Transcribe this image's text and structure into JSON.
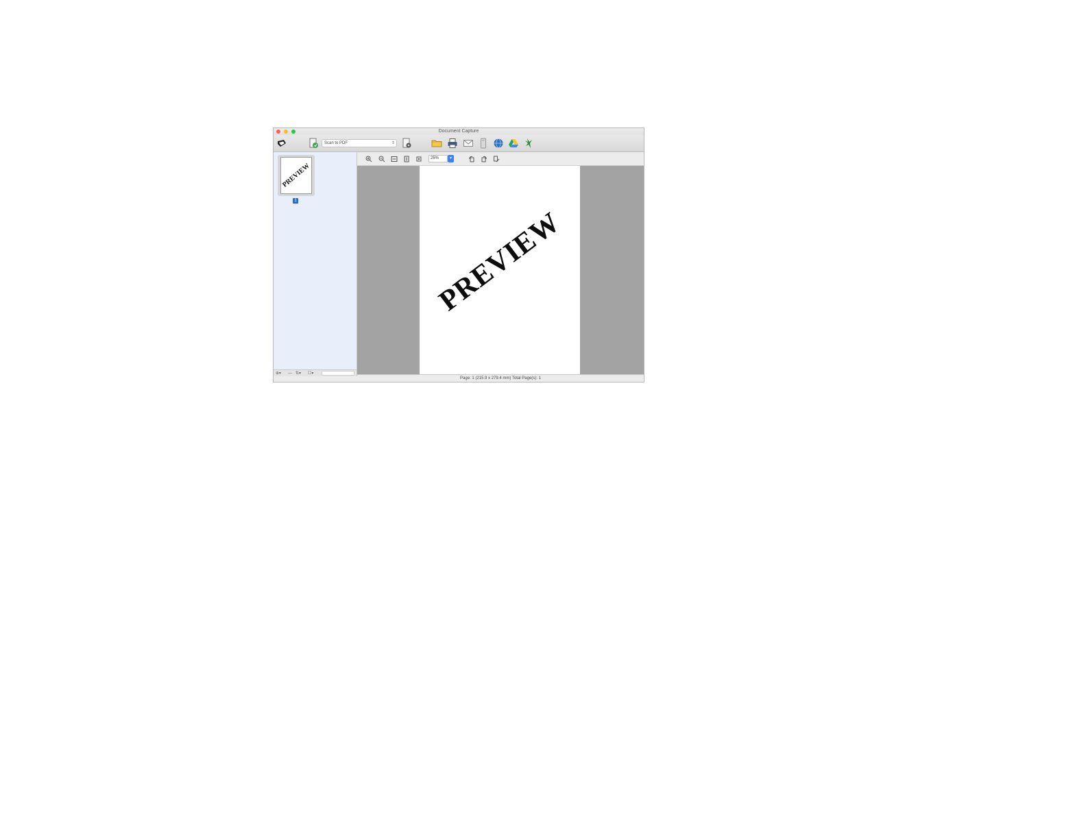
{
  "window": {
    "title": "Document Capture"
  },
  "toolbar": {
    "job_select": {
      "value": "Scan to PDF"
    },
    "icons": [
      "scanner-icon",
      "scan-job-icon",
      "job-settings-icon",
      "save-folder-icon",
      "print-icon",
      "email-icon",
      "send-to-app-icon",
      "web-service-icon",
      "google-drive-icon",
      "evernote-icon"
    ]
  },
  "sidebar": {
    "thumbnail": {
      "text": "PREVIEW",
      "page_number": "1"
    }
  },
  "viewer_toolbar": {
    "zoom_value": "25%"
  },
  "viewer": {
    "page_text": "PREVIEW"
  },
  "status": {
    "text": "Page: 1  (215.9 x 279.4 mm)  Total Page(s): 1"
  },
  "colors": {
    "sidebar_bg": "#e9effa",
    "viewer_bg": "#a3a3a3",
    "accent": "#3b82f6"
  }
}
